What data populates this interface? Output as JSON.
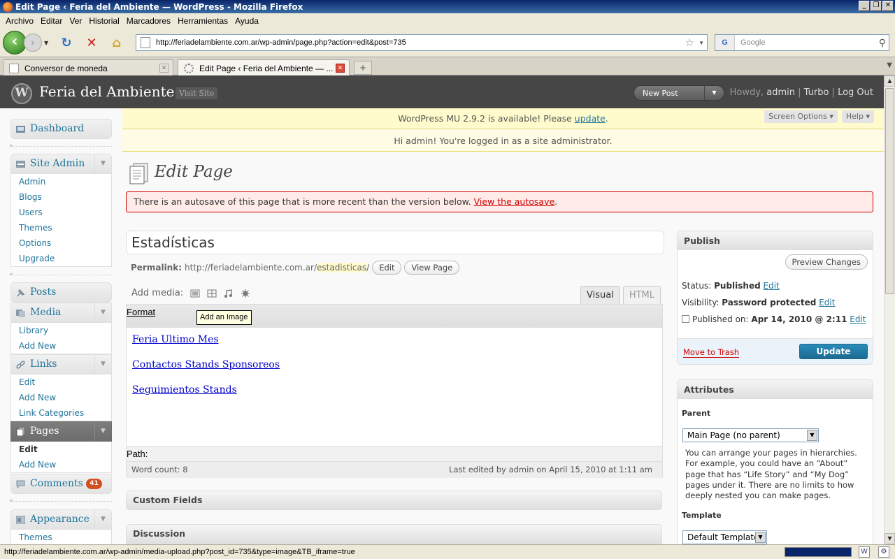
{
  "browser": {
    "window_title": "Edit Page ‹ Feria del Ambiente — WordPress - Mozilla Firefox",
    "menu": [
      "Archivo",
      "Editar",
      "Ver",
      "Historial",
      "Marcadores",
      "Herramientas",
      "Ayuda"
    ],
    "url": "http://feriadelambiente.com.ar/wp-admin/page.php?action=edit&post=735",
    "search_placeholder": "Google",
    "tabs": [
      {
        "label": "Conversor de moneda",
        "active": false
      },
      {
        "label": "Edit Page ‹ Feria del Ambiente — ...",
        "active": true
      }
    ],
    "status_text": "http://feriadelambiente.com.ar/wp-admin/media-upload.php?post_id=735&type=image&TB_iframe=true",
    "window_buttons": [
      "_",
      "❐",
      "✕"
    ]
  },
  "header": {
    "site_name": "Feria del Ambiente",
    "visit_site": "Visit Site",
    "favorite_action": "New Post",
    "howdy_prefix": "Howdy, ",
    "user": "admin",
    "separator": "|",
    "turbo": "Turbo",
    "logout": "Log Out"
  },
  "notices": {
    "update_prefix": "WordPress MU 2.9.2 is available! Please ",
    "update_link": "update",
    "update_suffix": ".",
    "screen_options": "Screen Options ▾",
    "help": "Help ▾",
    "admin_notice": "Hi admin! You're logged in as a site administrator."
  },
  "sidebar": {
    "dashboard": "Dashboard",
    "site_admin": {
      "label": "Site Admin",
      "items": [
        "Admin",
        "Blogs",
        "Users",
        "Themes",
        "Options",
        "Upgrade"
      ]
    },
    "posts": "Posts",
    "media": {
      "label": "Media",
      "items": [
        "Library",
        "Add New"
      ]
    },
    "links": {
      "label": "Links",
      "items": [
        "Edit",
        "Add New",
        "Link Categories"
      ]
    },
    "pages": {
      "label": "Pages",
      "items": [
        "Edit",
        "Add New"
      ],
      "current_item": "Edit"
    },
    "comments": {
      "label": "Comments",
      "count": "41"
    },
    "appearance": {
      "label": "Appearance",
      "items": [
        "Themes"
      ]
    }
  },
  "main": {
    "title": "Edit Page",
    "autosave_text": "There is an autosave of this page that is more recent than the version below. ",
    "autosave_link": "View the autosave",
    "autosave_suffix": ".",
    "post_title": "Estadísticas",
    "permalink_label": "Permalink:",
    "permalink_base": "http://feriadelambiente.com.ar/",
    "permalink_slug": "estadisticas",
    "permalink_trail": "/",
    "edit_btn": "Edit",
    "view_page_btn": "View Page",
    "add_media_label": "Add media:",
    "media_icons": [
      "image-icon",
      "video-icon",
      "audio-icon",
      "media-icon"
    ],
    "tab_visual": "Visual",
    "tab_html": "HTML",
    "format_label": "Format",
    "tooltip": "Add an Image",
    "content_links": [
      "Feria Ultimo Mes",
      "Contactos Stands Sponsoreos",
      "Seguimientos Stands"
    ],
    "path_label": "Path:",
    "word_count": "Word count: 8",
    "last_edited": "Last edited by admin on April 15, 2010 at 1:11 am",
    "custom_fields": "Custom Fields",
    "discussion": "Discussion"
  },
  "publish": {
    "title": "Publish",
    "preview": "Preview Changes",
    "status_label": "Status: ",
    "status_value": "Published",
    "visibility_label": "Visibility: ",
    "visibility_value": "Password protected",
    "published_label": "Published on: ",
    "published_value": "Apr 14, 2010 @ 2:11",
    "edit": "Edit",
    "trash": "Move to Trash",
    "update": "Update"
  },
  "attributes": {
    "title": "Attributes",
    "parent_label": "Parent",
    "parent_value": "Main Page (no parent)",
    "help": "You can arrange your pages in hierarchies. For example, you could have an “About” page that has “Life Story” and “My Dog” pages under it. There are no limits to how deeply nested you can make pages.",
    "template_label": "Template",
    "template_value": "Default Template"
  }
}
